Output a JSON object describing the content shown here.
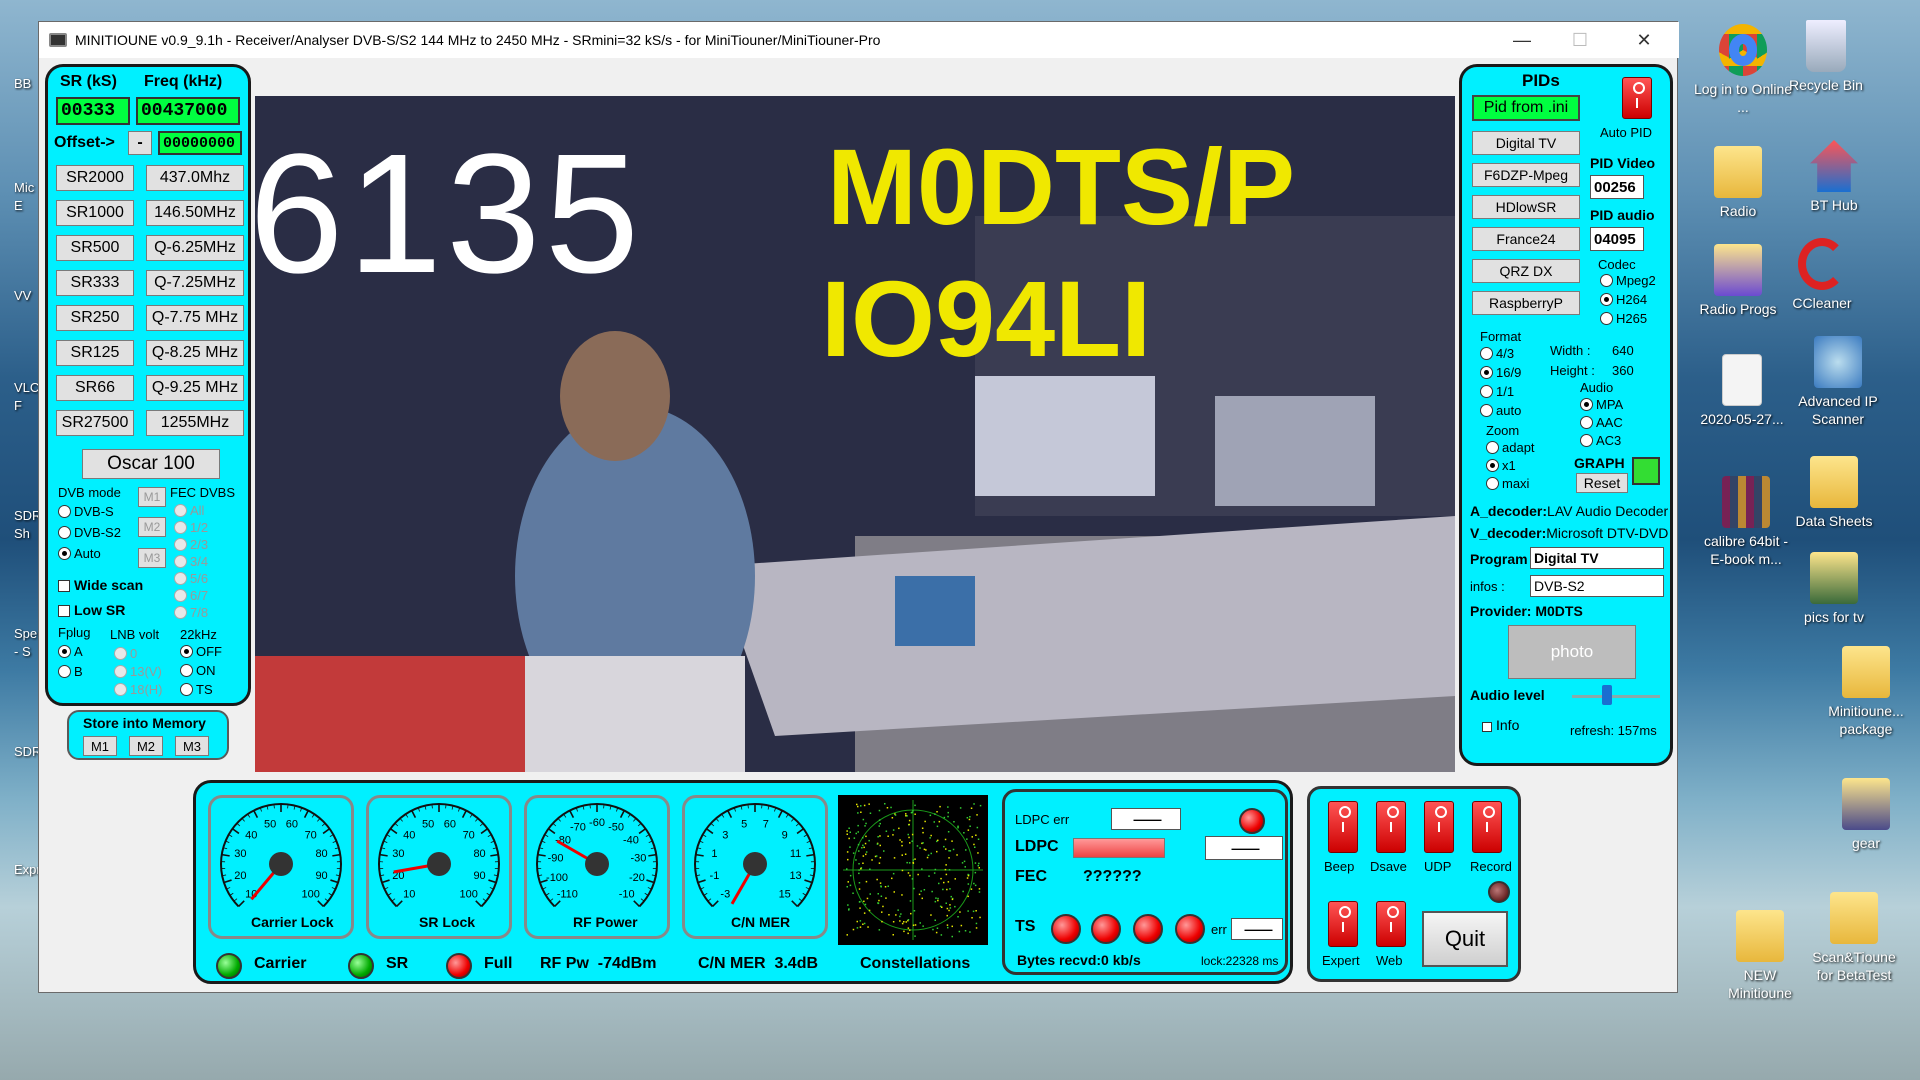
{
  "window": {
    "title": "MINITIOUNE v0.9_9.1h - Receiver/Analyser DVB-S/S2 144 MHz to 2450 MHz - SRmini=32 kS/s - for MiniTiouner/MiniTiouner-Pro",
    "minimize": "—",
    "maximize": "☐",
    "close": "✕"
  },
  "left": {
    "sr_header": "SR (kS)",
    "freq_header": "Freq (kHz)",
    "sr_value": "00333",
    "freq_value": "00437000",
    "offset_label": "Offset->",
    "offset_sign": "-",
    "offset_value": "00000000",
    "sr_buttons": [
      "SR2000",
      "SR1000",
      "SR500",
      "SR333",
      "SR250",
      "SR125",
      "SR66",
      "SR27500"
    ],
    "freq_buttons": [
      "437.0Mhz",
      "146.50MHz",
      "Q-6.25MHz",
      "Q-7.25MHz",
      "Q-7.75 MHz",
      "Q-8.25 MHz",
      "Q-9.25 MHz",
      "1255MHz"
    ],
    "oscar": "Oscar 100",
    "dvb_mode_label": "DVB mode",
    "dvb_modes": [
      "DVB-S",
      "DVB-S2",
      "Auto"
    ],
    "m_buttons": [
      "M1",
      "M2",
      "M3"
    ],
    "fec_label": "FEC DVBS",
    "fec_options": [
      "All",
      "1/2",
      "2/3",
      "3/4",
      "5/6",
      "6/7",
      "7/8"
    ],
    "wide_scan": "Wide scan",
    "low_sr": "Low SR",
    "fplug_label": "Fplug",
    "fplug_options": [
      "A",
      "B"
    ],
    "lnb_label": "LNB volt",
    "lnb_options": [
      "0",
      "13(V)",
      "18(H)"
    ],
    "khz_label": "22kHz",
    "khz_options": [
      "OFF",
      "ON",
      "TS"
    ],
    "store_label": "Store into Memory",
    "store_buttons": [
      "M1",
      "M2",
      "M3"
    ]
  },
  "video": {
    "sr_overlay": "6135",
    "call_overlay": "M0DTS/P",
    "grid_overlay": "IO94LI"
  },
  "right": {
    "pids_header": "PIDs",
    "pid_ini": "Pid from .ini",
    "auto_pid": "Auto PID",
    "presets": [
      "Digital TV",
      "F6DZP-Mpeg",
      "HDlowSR",
      "France24",
      "QRZ DX",
      "RaspberryP"
    ],
    "pid_video_label": "PID Video",
    "pid_video": "00256",
    "pid_audio_label": "PID audio",
    "pid_audio": "04095",
    "codec_label": "Codec",
    "codecs": [
      "Mpeg2",
      "H264",
      "H265"
    ],
    "format_label": "Format",
    "formats": [
      "4/3",
      "16/9",
      "1/1",
      "auto"
    ],
    "width_label": "Width :",
    "width": "640",
    "height_label": "Height :",
    "height": "360",
    "audio_label": "Audio",
    "audio_opts": [
      "MPA",
      "AAC",
      "AC3"
    ],
    "zoom_label": "Zoom",
    "zoom_opts": [
      "adapt",
      "x1",
      "maxi"
    ],
    "graph_label": "GRAPH",
    "reset": "Reset",
    "a_decoder_label": "A_decoder:",
    "a_decoder": "LAV Audio Decoder",
    "v_decoder_label": "V_decoder:",
    "v_decoder": "Microsoft DTV-DVD",
    "program_label": "Program",
    "program": "Digital TV",
    "infos_label": "infos :",
    "infos": "DVB-S2",
    "provider_label": "Provider:",
    "provider": "M0DTS",
    "photo": "photo",
    "audio_level_label": "Audio level",
    "audio_level": 0.4,
    "info": "Info",
    "refresh": "refresh: 157ms"
  },
  "bottom": {
    "gauges": [
      {
        "label": "Carrier Lock",
        "ticks": [
          "10",
          "20",
          "30",
          "40",
          "50",
          "60",
          "70",
          "80",
          "90",
          "100"
        ]
      },
      {
        "label": "SR Lock",
        "ticks": [
          "10",
          "20",
          "30",
          "40",
          "50",
          "60",
          "70",
          "80",
          "90",
          "100"
        ]
      },
      {
        "label": "RF Power",
        "ticks": [
          "-110",
          "-100",
          "-90",
          "-80",
          "-70",
          "-60",
          "-50",
          "-40",
          "-30",
          "-20",
          "-10"
        ]
      },
      {
        "label": "C/N MER",
        "ticks": [
          "-3",
          "-1",
          "1",
          "3",
          "5",
          "7",
          "9",
          "11",
          "13",
          "15"
        ]
      }
    ],
    "carrier": "Carrier",
    "sr": "SR",
    "full": "Full",
    "rf_pw_label": "RF Pw",
    "rf_pw": "-74dBm",
    "cn_mer_label": "C/N MER",
    "cn_mer": "3.4dB",
    "constellations": "Constellations",
    "ldpc_err": "LDPC err",
    "ldpc": "LDPC",
    "fec": "FEC",
    "fec_value": "??????",
    "box_dash": "——",
    "ts": "TS",
    "err": "err",
    "bytes": "Bytes recvd:0 kb/s",
    "lock": "lock:22328 ms",
    "beep": "Beep",
    "dsave": "Dsave",
    "udp": "UDP",
    "record": "Record",
    "expert": "Expert",
    "web": "Web",
    "quit": "Quit"
  },
  "desktop": {
    "icons": [
      {
        "label": "Log in to Online ..."
      },
      {
        "label": "Recycle Bin"
      },
      {
        "label": "Radio"
      },
      {
        "label": "BT Hub"
      },
      {
        "label": "Radio Progs"
      },
      {
        "label": "CCleaner"
      },
      {
        "label": "2020-05-27..."
      },
      {
        "label": "Advanced IP Scanner"
      },
      {
        "label": "calibre 64bit - E-book m..."
      },
      {
        "label": "Data Sheets"
      },
      {
        "label": "pics for tv"
      },
      {
        "label": "Minitioune... package"
      },
      {
        "label": "gear"
      },
      {
        "label": "NEW Minitioune"
      },
      {
        "label": "Scan&Tioune for BetaTest"
      }
    ],
    "left_strip": [
      "BB",
      "Mic",
      "E",
      "VV",
      "VLC",
      "F",
      "SDR",
      "Sh",
      "Spe",
      "- S",
      "SDRC",
      "Expr"
    ]
  }
}
